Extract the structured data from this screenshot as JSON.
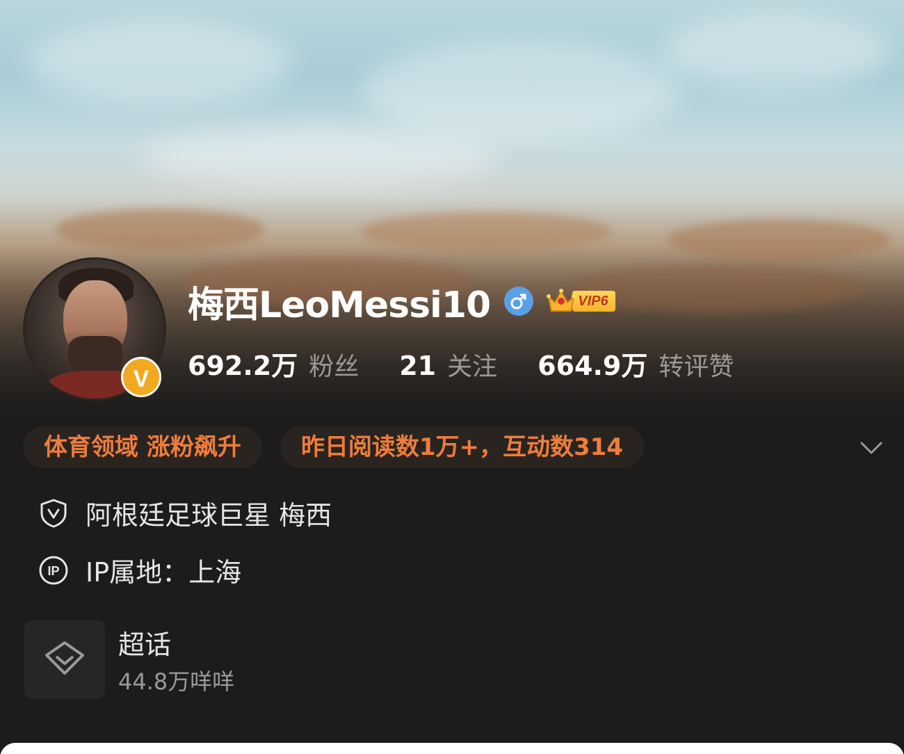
{
  "profile": {
    "name": "梅西LeoMessi10",
    "vip_label": "VIP6",
    "verified_badge": "V",
    "stats": [
      {
        "value": "692.2万",
        "label": "粉丝"
      },
      {
        "value": "21",
        "label": "关注"
      },
      {
        "value": "664.9万",
        "label": "转评赞"
      }
    ]
  },
  "tags": [
    "体育领域 涨粉飙升",
    "昨日阅读数1万+，互动数314"
  ],
  "info": {
    "verification": "阿根廷足球巨星 梅西",
    "ip_location": "IP属地：上海",
    "ip_icon_text": "IP"
  },
  "supertopic": {
    "title": "超话",
    "subtitle": "44.8万咩咩"
  },
  "icons": {
    "gender": "male-icon",
    "verification": "shield-v-icon",
    "ip": "ip-icon",
    "supertopic": "diamond-icon",
    "expand": "chevron-down-icon"
  },
  "colors": {
    "background": "#1c1c1c",
    "tag_text": "#ee7d3c",
    "verified_badge": "#f2a91f",
    "gender_icon": "#5aa0e6",
    "vip_gold": "#f6b52c"
  }
}
